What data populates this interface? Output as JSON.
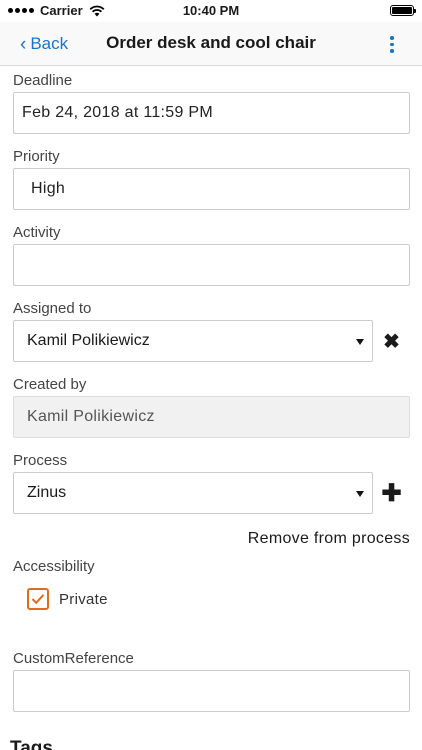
{
  "status_bar": {
    "carrier": "Carrier",
    "time": "10:40 PM",
    "battery_level": 1.0
  },
  "nav": {
    "back_label": "Back",
    "title": "Order desk and cool chair",
    "more_icon": "more-vertical-icon",
    "accent": "#1a73c8"
  },
  "form": {
    "deadline": {
      "label": "Deadline",
      "value": "Feb 24, 2018 at 11:59 PM"
    },
    "priority": {
      "label": "Priority",
      "value": "High"
    },
    "activity": {
      "label": "Activity",
      "value": ""
    },
    "assigned_to": {
      "label": "Assigned to",
      "value": "Kamil Polikiewicz",
      "clear_icon": "close-icon"
    },
    "created_by": {
      "label": "Created by",
      "value": "Kamil Polikiewicz"
    },
    "process": {
      "label": "Process",
      "value": "Zinus",
      "add_icon": "plus-icon",
      "remove_label": "Remove from process"
    },
    "accessibility": {
      "label": "Accessibility",
      "private_label": "Private",
      "private_checked": true,
      "checkbox_color": "#e06b1f"
    },
    "custom_reference": {
      "label": "CustomReference",
      "value": ""
    },
    "tags": {
      "label": "Tags"
    }
  }
}
